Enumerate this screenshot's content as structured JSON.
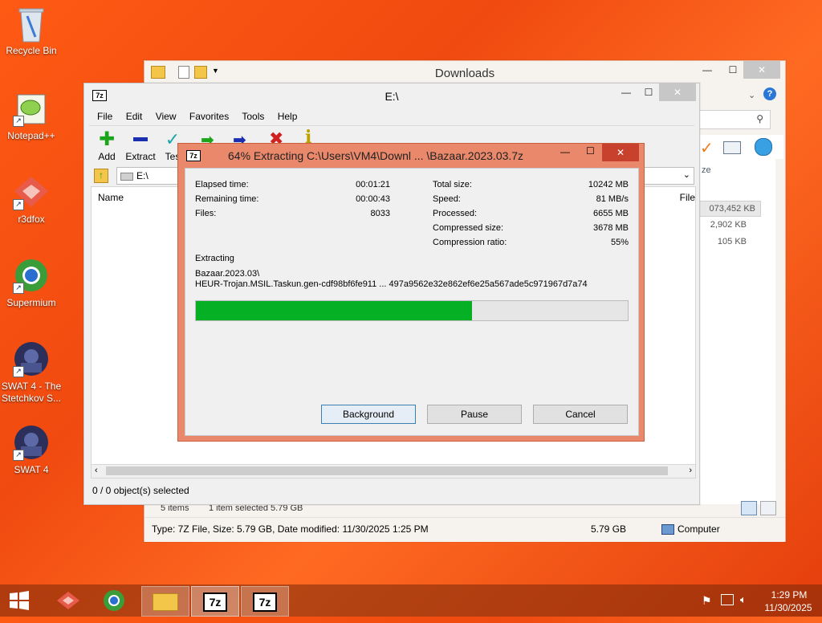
{
  "desktop": {
    "icons": [
      {
        "label": "Recycle Bin"
      },
      {
        "label": "Notepad++"
      },
      {
        "label": "r3dfox"
      },
      {
        "label": "Supermium"
      },
      {
        "label": "SWAT 4 - The Stetchkov S..."
      },
      {
        "label": "SWAT 4"
      }
    ]
  },
  "explorer": {
    "title": "Downloads",
    "column_size": "ze",
    "sizes": [
      "073,452 KB",
      "2,902 KB",
      "105 KB"
    ],
    "status_items": "5 items",
    "status_selected": "1 item selected  5.79 GB",
    "details": "Type: 7Z File, Size: 5.79 GB, Date modified: 11/30/2025 1:25 PM",
    "details_size": "5.79 GB",
    "details_location": "Computer"
  },
  "sevenzip": {
    "app_icon": "7z",
    "title": "E:\\",
    "menu": [
      "File",
      "Edit",
      "View",
      "Favorites",
      "Tools",
      "Help"
    ],
    "toolbar": [
      {
        "label": "Add",
        "icon": "plus-icon",
        "color": "#1aa51a"
      },
      {
        "label": "Extract",
        "icon": "minus-icon",
        "color": "#1a2fb0"
      },
      {
        "label": "Tes",
        "icon": "check-icon",
        "color": "#1aa8a8"
      }
    ],
    "address": "E:\\",
    "column_name": "Name",
    "column_file": "File",
    "status": "0 / 0 object(s) selected"
  },
  "dialog": {
    "title": "64% Extracting C:\\Users\\VM4\\Downl ... \\Bazaar.2023.03.7z",
    "left_labels": [
      "Elapsed time:",
      "Remaining time:",
      "Files:"
    ],
    "left_values": [
      "00:01:21",
      "00:00:43",
      "8033"
    ],
    "right_labels": [
      "Total size:",
      "Speed:",
      "Processed:",
      "Compressed size:",
      "Compression ratio:"
    ],
    "right_values": [
      "10242 MB",
      "81 MB/s",
      "6655 MB",
      "3678 MB",
      "55%"
    ],
    "operation": "Extracting",
    "path_line1": "Bazaar.2023.03\\",
    "path_line2": "HEUR-Trojan.MSIL.Taskun.gen-cdf98bf6fe911 ... 497a9562e32e862ef6e25a567ade5c971967d7a74",
    "progress": 0.64,
    "progress_color": "#06b025",
    "buttons": {
      "background": "Background",
      "pause": "Pause",
      "cancel": "Cancel"
    }
  },
  "taskbar": {
    "time": "1:29 PM",
    "date": "11/30/2025",
    "app_7z_a": "7z",
    "app_7z_b": "7z"
  }
}
